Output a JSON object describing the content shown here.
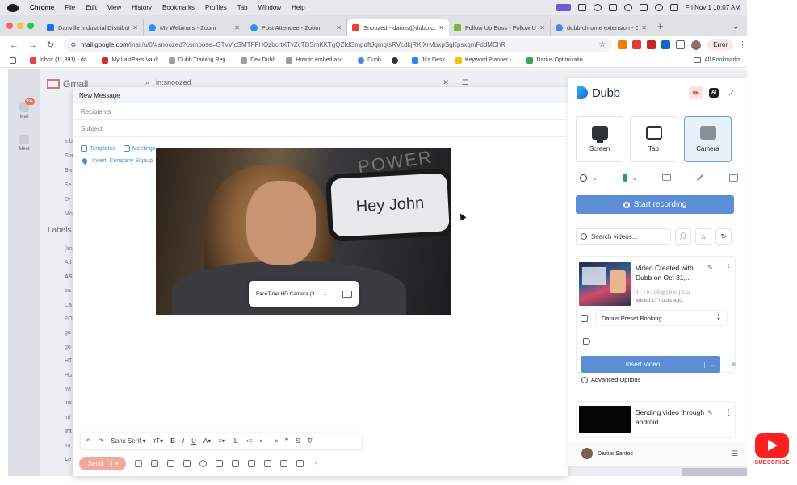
{
  "menubar": {
    "app": "Chrome",
    "items": [
      "File",
      "Edit",
      "View",
      "History",
      "Bookmarks",
      "Profiles",
      "Tab",
      "Window",
      "Help"
    ],
    "clock": "Fri Nov 1  10:07 AM"
  },
  "tabs": [
    {
      "title": "Danville Industrial Distributor",
      "color": "#1a73e8"
    },
    {
      "title": "My Webinars - Zoom",
      "color": "#2d8cff"
    },
    {
      "title": "Post Attendee - Zoom",
      "color": "#2d8cff"
    },
    {
      "title": "Snoozed - darius@dubb.com",
      "color": "#ea4335"
    },
    {
      "title": "Follow Up Boss - Follow Up B",
      "color": "#7cb342"
    },
    {
      "title": "dubb chrome extension - Goo",
      "color": "#4285f4"
    }
  ],
  "toolbar": {
    "url_host": "mail.google.com",
    "url_path": "/mail/u/0/#snoozed?compose=GTvVlcSMTFFHQzbcrtXTvZcTDSmKKTgQZfdGmpdftJgmqtsRVcdkjRKjXrMbxpSgKpsxqmFddMChR",
    "error_label": "Error"
  },
  "bookmarks": [
    {
      "label": "Inbox (11,391) - da...",
      "color": "#ea4335"
    },
    {
      "label": "My LastPass Vault",
      "color": "#d32f2f"
    },
    {
      "label": "Dubb Training Reg...",
      "color": "#9e9e9e"
    },
    {
      "label": "Dev Dubb",
      "color": "#9e9e9e"
    },
    {
      "label": "How to embed a vi...",
      "color": "#9e9e9e"
    },
    {
      "label": "Dubb",
      "color": "#4285f4"
    },
    {
      "label": "",
      "color": "#333333"
    },
    {
      "label": "Jira Desk",
      "color": "#2684ff"
    },
    {
      "label": "Keyword Planner -...",
      "color": "#fbbc04"
    },
    {
      "label": "Darius Optimizatio...",
      "color": "#34a853"
    }
  ],
  "all_bookmarks": "All Bookmarks",
  "gmail": {
    "logo": "Gmail",
    "search_value": "in:snoozed",
    "mail_label": "Mail",
    "mail_badge": "99+",
    "meet_label": "Meet",
    "nav_items": [
      "Inb",
      "Sta",
      "Sn",
      "Se",
      "Dr",
      "Mo"
    ],
    "labels_heading": "Labels",
    "label_items": [
      "[Im",
      "Ad",
      "AS",
      "ba",
      "Ca",
      "FO",
      "ga",
      "go",
      "HT",
      "Hu",
      "IM",
      "ins",
      "int",
      "int",
      "ko",
      "Le"
    ]
  },
  "compose": {
    "title": "New Message",
    "recipients_placeholder": "Recipients",
    "subject_placeholder": "Subject",
    "templates": "Templates",
    "meetings": "Meetings",
    "insert_signup": "Insert: Company Signup",
    "font_name": "Sans Serif",
    "send_label": "Send"
  },
  "video": {
    "phone_text": "Hey John",
    "bg_text": "POWER",
    "camera_select": "FaceTime HD Camera (3..."
  },
  "dubb": {
    "brand": "Dubb",
    "ai_label": "AI",
    "modes": [
      {
        "label": "Screen",
        "selected": false
      },
      {
        "label": "Tab",
        "selected": false
      },
      {
        "label": "Camera",
        "selected": true
      }
    ],
    "start_recording": "Start recording",
    "search_placeholder": "Search videos...",
    "video1": {
      "title": "Video Created with Dubb on Oct 31,...",
      "stats": "0 ◌ | 0 ♪ | 0 ◎ | 0 ▭ | 0 ▭",
      "added": "added 17 hours ago",
      "booking": "Darius Preset Booking",
      "insert_label": "Insert Video"
    },
    "advanced_options": "Advanced Options",
    "video2": {
      "title": "Sending video through android"
    },
    "user_name": "Darius Santos",
    "accent": "#5b8ed6"
  },
  "subscribe_label": "SUBSCRIBE"
}
